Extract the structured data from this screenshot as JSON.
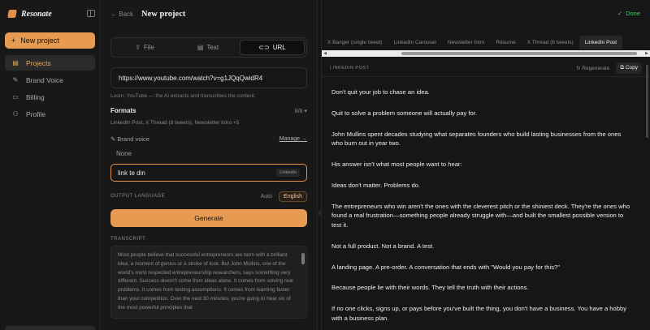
{
  "sidebar": {
    "brand_name": "Resonate",
    "new_project_label": "New project",
    "items": [
      {
        "label": "Projects",
        "icon": "folder-icon"
      },
      {
        "label": "Brand Voice",
        "icon": "pen-icon"
      },
      {
        "label": "Billing",
        "icon": "card-icon"
      },
      {
        "label": "Profile",
        "icon": "user-icon"
      }
    ]
  },
  "header": {
    "back_label": "Back",
    "title": "New project",
    "done_label": "Done"
  },
  "source": {
    "tabs": [
      {
        "label": "File"
      },
      {
        "label": "Text"
      },
      {
        "label": "URL"
      }
    ],
    "url_value": "https://www.youtube.com/watch?v=g1JQqQwidR4",
    "hint": "Loom, YouTube — the AI extracts and transcribes the content."
  },
  "formats": {
    "label": "Formats",
    "count": "8/8 ▾",
    "summary": "LinkedIn Post, X Thread (8 tweets), Newsletter Intro +5"
  },
  "brand_voice": {
    "label": "Brand voice",
    "manage_label": "Manage →",
    "none_option": "None",
    "value": "link te din",
    "tag": "LinkedIn"
  },
  "output_language": {
    "label": "OUTPUT LANGUAGE",
    "auto": "Auto",
    "selected": "English"
  },
  "generate_label": "Generate",
  "transcript": {
    "label": "TRANSCRIPT",
    "text": "Most people believe that successful entrepreneurs are born with a brilliant idea, a moment of genius or a stroke of luck. But John Mullins, one of the world's most respected entrepreneurship researchers, says something very different. Success doesn't come from ideas alone. It comes from solving real problems. It comes from testing assumptions. It comes from learning faster than your competition. Over the next 30 minutes, you're going to hear six of the most powerful principles that"
  },
  "output": {
    "tabs": [
      {
        "label": "X Banger (single tweet)"
      },
      {
        "label": "LinkedIn Carousel"
      },
      {
        "label": "Newsletter Intro"
      },
      {
        "label": "Résumé"
      },
      {
        "label": "X Thread (8 tweets)"
      },
      {
        "label": "LinkedIn Post"
      }
    ],
    "post_title": "LINKEDIN POST",
    "regenerate_label": "Regenerate",
    "copy_label": "Copy",
    "paragraphs": [
      "Don't quit your job to chase an idea.",
      "Quit to solve a problem someone will actually pay for.",
      "John Mullins spent decades studying what separates founders who build lasting businesses from the ones who burn out in year two.",
      "His answer isn't what most people want to hear:",
      "Ideas don't matter. Problems do.",
      "The entrepreneurs who win aren't the ones with the cleverest pitch or the shiniest deck. They're the ones who found a real frustration—something people already struggle with—and built the smallest possible version to test it.",
      "Not a full product. Not a brand. A test.",
      "A landing page. A pre-order. A conversation that ends with \"Would you pay for this?\"",
      "Because people lie with their words. They tell the truth with their actions.",
      "If no one clicks, signs up, or pays before you've built the thing, you don't have a business. You have a hobby with a business plan."
    ]
  },
  "colors": {
    "accent": "#e79a52",
    "done": "#4cc76a",
    "background": "#141414"
  }
}
